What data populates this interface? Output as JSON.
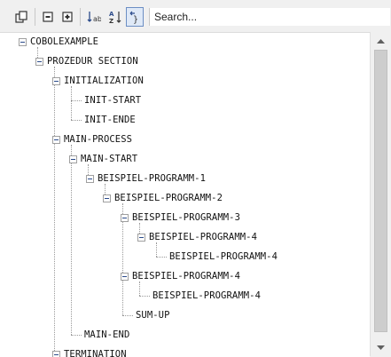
{
  "toolbar": {
    "search_placeholder": "Search...",
    "buttons": [
      "sync-with-editor-icon",
      "collapse-all-icon",
      "expand-all-icon",
      "sort-ascending-icon",
      "sort-alphabetical-icon",
      "toggle-braces-icon"
    ],
    "active_button": "toggle-braces-icon"
  },
  "tree": {
    "root": "COBOLEXAMPLE",
    "prozedur_section": "PROZEDUR SECTION",
    "initialization": "INITIALIZATION",
    "init_start": "INIT-START",
    "init_ende": "INIT-ENDE",
    "main_process": "MAIN-PROCESS",
    "main_start": "MAIN-START",
    "bp1": "BEISPIEL-PROGRAMM-1",
    "bp2": "BEISPIEL-PROGRAMM-2",
    "bp3": "BEISPIEL-PROGRAMM-3",
    "bp4a": "BEISPIEL-PROGRAMM-4",
    "bp4a_child": "BEISPIEL-PROGRAMM-4",
    "bp4b": "BEISPIEL-PROGRAMM-4",
    "bp4b_child": "BEISPIEL-PROGRAMM-4",
    "sum_up": "SUM-UP",
    "main_end": "MAIN-END",
    "termination": "TERMINATION"
  },
  "colors": {
    "tree_line": "#9a9a9a",
    "active_button_border": "#6c8ec4",
    "expander_minus": "#2a4a8a"
  }
}
